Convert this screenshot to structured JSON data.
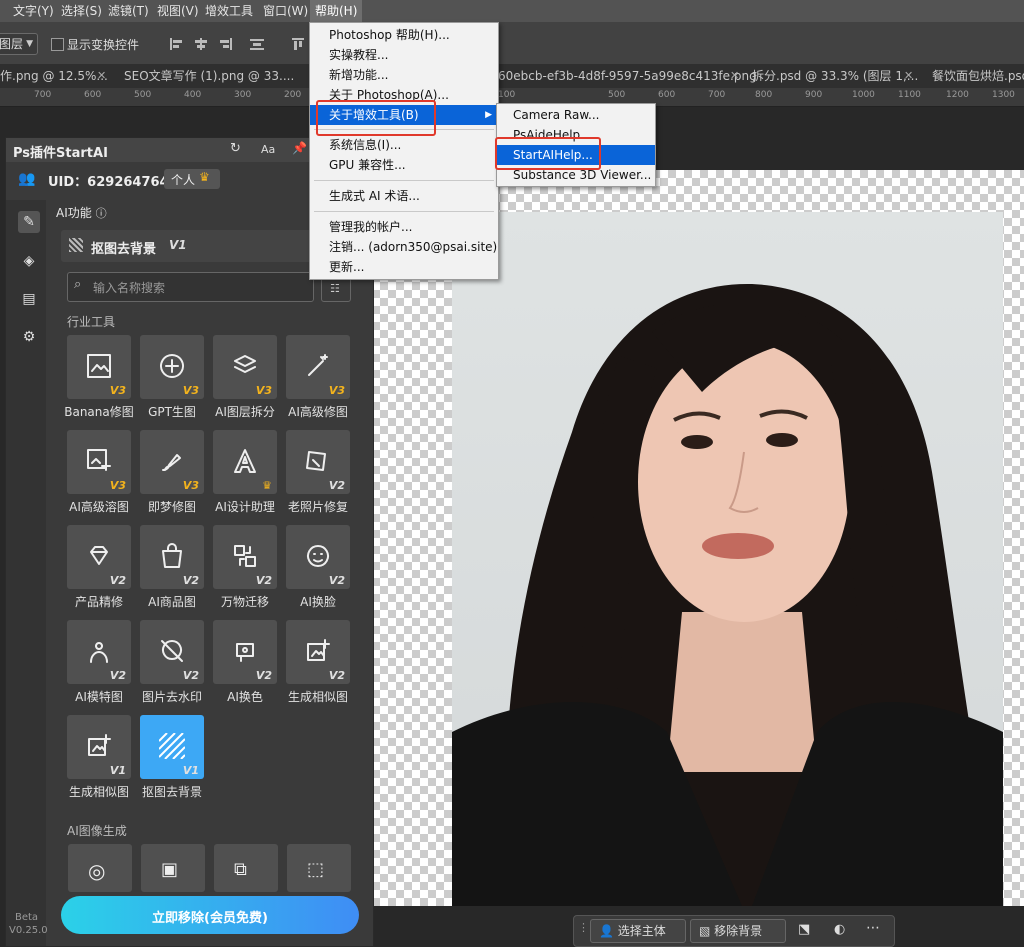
{
  "menubar": {
    "items": [
      "文字(Y)",
      "选择(S)",
      "滤镜(T)",
      "视图(V)",
      "增效工具",
      "窗口(W)",
      "帮助(H)"
    ]
  },
  "options": {
    "layer_select": "图层",
    "show_transform": "显示变换控件"
  },
  "tabs": [
    {
      "label": "作.png @ 12.5%..."
    },
    {
      "label": "SEO文章写作 (1).png @ 33...."
    },
    {
      "label": "60ebcb-ef3b-4d8f-9597-5a99e8c413fe.png"
    },
    {
      "label": "拆分.psd @ 33.3% (图层 1,..."
    },
    {
      "label": "餐饮面包烘焙.psd"
    }
  ],
  "ruler": [
    "700",
    "600",
    "500",
    "400",
    "300",
    "200",
    "100",
    "500",
    "600",
    "700",
    "800",
    "900",
    "1000",
    "1100",
    "1200",
    "1300"
  ],
  "help_menu": {
    "items": [
      "Photoshop 帮助(H)...",
      "实操教程...",
      "新增功能...",
      "关于 Photoshop(A)...",
      "关于增效工具(B)",
      "系统信息(I)...",
      "GPU 兼容性...",
      "生成式 AI 术语...",
      "管理我的帐户...",
      "注销... (adorn350@psai.site)",
      "更新..."
    ]
  },
  "submenu": {
    "items": [
      "Camera Raw...",
      "PsAideHelp...",
      "StartAIHelp...",
      "Substance 3D Viewer..."
    ]
  },
  "panel": {
    "title": "Ps插件StartAI",
    "header_aa": "Aa",
    "uid": "UID：629264764",
    "account": "个人",
    "section_ai": "AI功能",
    "current_tool": "抠图去背景",
    "current_ver": "V1",
    "search_placeholder": "输入名称搜索",
    "section_industry": "行业工具",
    "section_image_gen": "AI图像生成",
    "remove_button": "立即移除(会员免费)",
    "beta": "Beta",
    "version": "V0.25.0",
    "tools": [
      {
        "label": "Banana修图",
        "ver": "V3",
        "icon": "image-edit-icon"
      },
      {
        "label": "GPT生图",
        "ver": "V3",
        "icon": "gpt-logo-icon"
      },
      {
        "label": "AI图层拆分",
        "ver": "V3",
        "icon": "layer-split-icon"
      },
      {
        "label": "AI高级修图",
        "ver": "V3",
        "icon": "magic-wand-icon"
      },
      {
        "label": "AI高级溶图",
        "ver": "V3",
        "icon": "image-sparkle-icon"
      },
      {
        "label": "即梦修图",
        "ver": "V3",
        "icon": "brush-icon"
      },
      {
        "label": "AI设计助理",
        "ver": "",
        "icon": "design-assistant-icon"
      },
      {
        "label": "老照片修复",
        "ver": "V2",
        "icon": "photo-restore-icon"
      },
      {
        "label": "产品精修",
        "ver": "V2",
        "icon": "diamond-icon"
      },
      {
        "label": "AI商品图",
        "ver": "V2",
        "icon": "product-bag-icon"
      },
      {
        "label": "万物迁移",
        "ver": "V2",
        "icon": "transfer-icon"
      },
      {
        "label": "AI换脸",
        "ver": "V2",
        "icon": "face-swap-icon"
      },
      {
        "label": "AI模特图",
        "ver": "V2",
        "icon": "model-icon"
      },
      {
        "label": "图片去水印",
        "ver": "V2",
        "icon": "watermark-remove-icon"
      },
      {
        "label": "AI换色",
        "ver": "V2",
        "icon": "color-change-icon"
      },
      {
        "label": "生成相似图",
        "ver": "V2",
        "icon": "similar-image-icon"
      },
      {
        "label": "生成相似图",
        "ver": "V1",
        "icon": "similar-image-icon"
      },
      {
        "label": "抠图去背景",
        "ver": "V1",
        "icon": "cutout-icon"
      }
    ]
  },
  "ctx_bar": {
    "select_subject": "选择主体",
    "remove_bg": "移除背景"
  },
  "colors": {
    "accent": "#0a64d8",
    "selected_tool": "#3da8f5",
    "version_gold": "#f3b31d",
    "red_highlight": "#e0392b"
  }
}
